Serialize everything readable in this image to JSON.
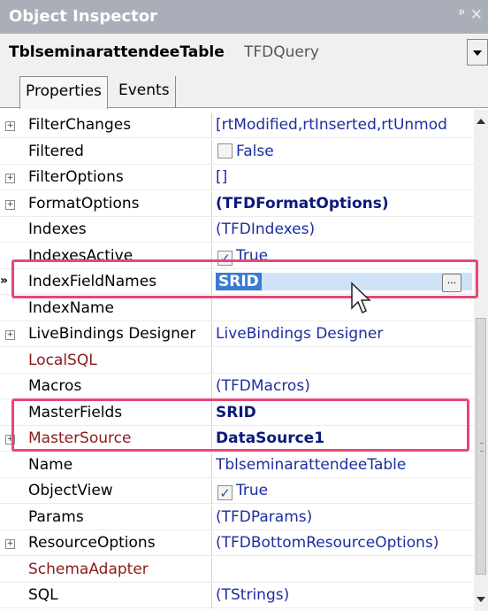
{
  "window": {
    "title": "Object Inspector",
    "pin_glyph": "ᵖ",
    "close_glyph": "✕"
  },
  "object": {
    "name": "TblseminarattendeeTable",
    "type": "TFDQuery"
  },
  "tabs": [
    {
      "label": "Properties"
    },
    {
      "label": "Events"
    }
  ],
  "properties": [
    {
      "name": "FilterChanges",
      "value": "[rtModified,rtInserted,rtUnmod",
      "expandable": true
    },
    {
      "name": "Filtered",
      "value": "False",
      "checkbox": true,
      "checked": false
    },
    {
      "name": "FilterOptions",
      "value": "[]",
      "expandable": true
    },
    {
      "name": "FormatOptions",
      "value": "(TFDFormatOptions)",
      "expandable": true,
      "bold": true
    },
    {
      "name": "Indexes",
      "value": "(TFDIndexes)"
    },
    {
      "name": "IndexesActive",
      "value": "True",
      "checkbox": true,
      "checked": true
    },
    {
      "name": "IndexFieldNames",
      "value": "SRID",
      "selected": true,
      "ellipsis": "..."
    },
    {
      "name": "IndexName",
      "value": ""
    },
    {
      "name": "LiveBindings Designer",
      "value": "LiveBindings Designer",
      "expandable": true
    },
    {
      "name": "LocalSQL",
      "value": "",
      "special": true
    },
    {
      "name": "Macros",
      "value": "(TFDMacros)"
    },
    {
      "name": "MasterFields",
      "value": "SRID",
      "bold": true
    },
    {
      "name": "MasterSource",
      "value": "DataSource1",
      "expandable": true,
      "bold": true,
      "special": true
    },
    {
      "name": "Name",
      "value": "TblseminarattendeeTable"
    },
    {
      "name": "ObjectView",
      "value": "True",
      "checkbox": true,
      "checked": true
    },
    {
      "name": "Params",
      "value": "(TFDParams)"
    },
    {
      "name": "ResourceOptions",
      "value": "(TFDBottomResourceOptions)",
      "expandable": true
    },
    {
      "name": "SchemaAdapter",
      "value": "",
      "special": true
    },
    {
      "name": "SQL",
      "value": "(TStrings)"
    }
  ],
  "colors": {
    "highlight": "#e8467a",
    "selection": "#3a7bd5",
    "special_name": "#8b1a1a",
    "value_blue": "#1c2ea0"
  }
}
